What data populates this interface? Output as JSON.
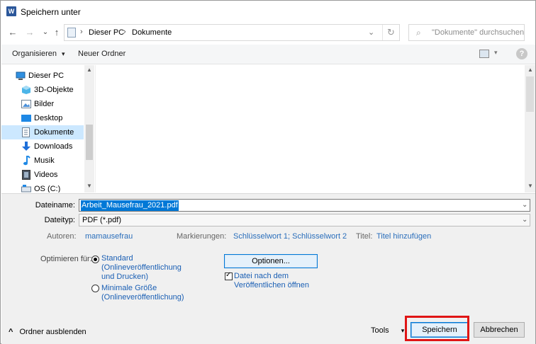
{
  "window": {
    "title": "Speichern unter",
    "app_icon": "word-icon",
    "app_icon_letter": "W"
  },
  "nav": {
    "back": "←",
    "forward": "→",
    "recent": "⌄",
    "up": "↑",
    "path": [
      "Dieser PC",
      "Dokumente"
    ],
    "separator": "›",
    "dropdown": "⌄",
    "refresh": "↻"
  },
  "search": {
    "icon": "⌕",
    "placeholder": "\"Dokumente\" durchsuchen"
  },
  "toolbar": {
    "organize_label": "Organisieren",
    "organize_arrow": "▾",
    "new_folder_label": "Neuer Ordner",
    "view_arrow": "▾",
    "help_label": "?"
  },
  "navigation": {
    "items": [
      {
        "label": "Dieser PC",
        "icon": "computer-icon",
        "selected": false
      },
      {
        "label": "3D-Objekte",
        "icon": "cube-icon",
        "selected": false
      },
      {
        "label": "Bilder",
        "icon": "pictures-icon",
        "selected": false
      },
      {
        "label": "Desktop",
        "icon": "desktop-icon",
        "selected": false
      },
      {
        "label": "Dokumente",
        "icon": "document-icon",
        "selected": true
      },
      {
        "label": "Downloads",
        "icon": "download-icon",
        "selected": false
      },
      {
        "label": "Musik",
        "icon": "music-icon",
        "selected": false
      },
      {
        "label": "Videos",
        "icon": "video-icon",
        "selected": false
      },
      {
        "label": "OS (C:)",
        "icon": "drive-icon",
        "selected": false
      }
    ],
    "scroll_up": "▲",
    "scroll_down": "▼"
  },
  "save_form": {
    "filename_label": "Dateiname:",
    "filename_value": "Arbeit_Mausefrau_2021.pdf",
    "filetype_label": "Dateityp:",
    "filetype_value": "PDF (*.pdf)",
    "dd_arrow": "⌄",
    "authors_label": "Autoren:",
    "authors_value": "mamausefrau",
    "tags_label": "Markierungen:",
    "tags_value": "Schlüsselwort 1; Schlüsselwort 2",
    "title_label": "Titel:",
    "title_value": "Titel hinzufügen"
  },
  "optimize": {
    "label": "Optimieren für:",
    "standard_label": "Standard (Onlineveröffentlichung und Drucken)",
    "standard_checked": true,
    "minimal_label": "Minimale Größe (Onlineveröffentlichung)",
    "minimal_checked": false,
    "options_button": "Optionen...",
    "open_after_label": "Datei nach dem Veröffentlichen öffnen",
    "open_after_checked": true
  },
  "footer": {
    "hide_folders_label": "Ordner ausblenden",
    "hide_folders_arrow": "^",
    "tools_label": "Tools",
    "tools_arrow": "▾",
    "save_button": "Speichern",
    "cancel_button": "Abbrechen"
  },
  "colors": {
    "selection": "#0078d7",
    "nav_selected": "#cce8ff",
    "link": "#1a5fb4",
    "highlight_box": "#e01515"
  }
}
